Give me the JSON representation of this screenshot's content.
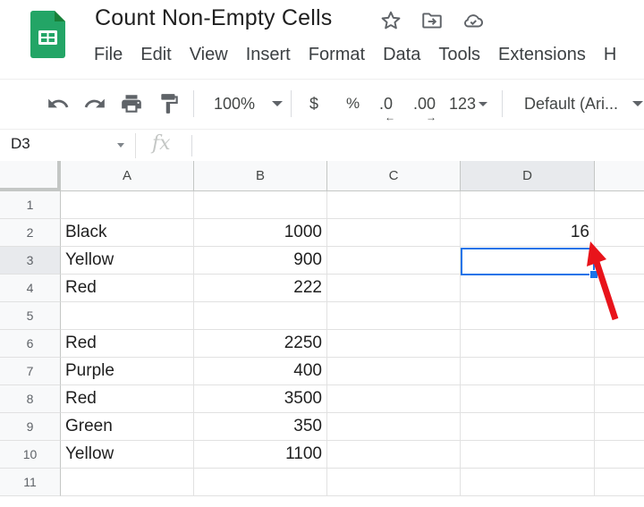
{
  "app": {
    "title": "Count Non-Empty Cells",
    "title_icons": [
      "star-icon",
      "move-to-folder-icon",
      "cloud-saved-icon"
    ]
  },
  "menu": [
    "File",
    "Edit",
    "View",
    "Insert",
    "Format",
    "Data",
    "Tools",
    "Extensions",
    "H"
  ],
  "toolbar": {
    "icons": [
      "undo-icon",
      "redo-icon",
      "print-icon",
      "paint-format-icon"
    ],
    "zoom": "100%",
    "currency": "$",
    "percent": "%",
    "decrease_decimal": ".0",
    "increase_decimal": ".00",
    "more_formats": "123",
    "font": "Default (Ari..."
  },
  "formula_bar": {
    "name_box": "D3",
    "fx": "fx",
    "value": ""
  },
  "sheet": {
    "columns": [
      "A",
      "B",
      "C",
      "D"
    ],
    "selected_cell": "D3",
    "rows": [
      {
        "n": "1",
        "A": "",
        "B": "",
        "C": "",
        "D": ""
      },
      {
        "n": "2",
        "A": "Black",
        "B": "1000",
        "C": "",
        "D": "16"
      },
      {
        "n": "3",
        "A": "Yellow",
        "B": "900",
        "C": "",
        "D": ""
      },
      {
        "n": "4",
        "A": "Red",
        "B": "222",
        "C": "",
        "D": ""
      },
      {
        "n": "5",
        "A": "",
        "B": "",
        "C": "",
        "D": ""
      },
      {
        "n": "6",
        "A": "Red",
        "B": "2250",
        "C": "",
        "D": ""
      },
      {
        "n": "7",
        "A": "Purple",
        "B": "400",
        "C": "",
        "D": ""
      },
      {
        "n": "8",
        "A": "Red",
        "B": "3500",
        "C": "",
        "D": ""
      },
      {
        "n": "9",
        "A": "Green",
        "B": "350",
        "C": "",
        "D": ""
      },
      {
        "n": "10",
        "A": "Yellow",
        "B": "1100",
        "C": "",
        "D": ""
      },
      {
        "n": "11",
        "A": "",
        "B": "",
        "C": "",
        "D": ""
      }
    ]
  },
  "colors": {
    "accent": "#1a73e8",
    "annotation_arrow": "#e8141b",
    "sheets_green": "#23a566"
  }
}
